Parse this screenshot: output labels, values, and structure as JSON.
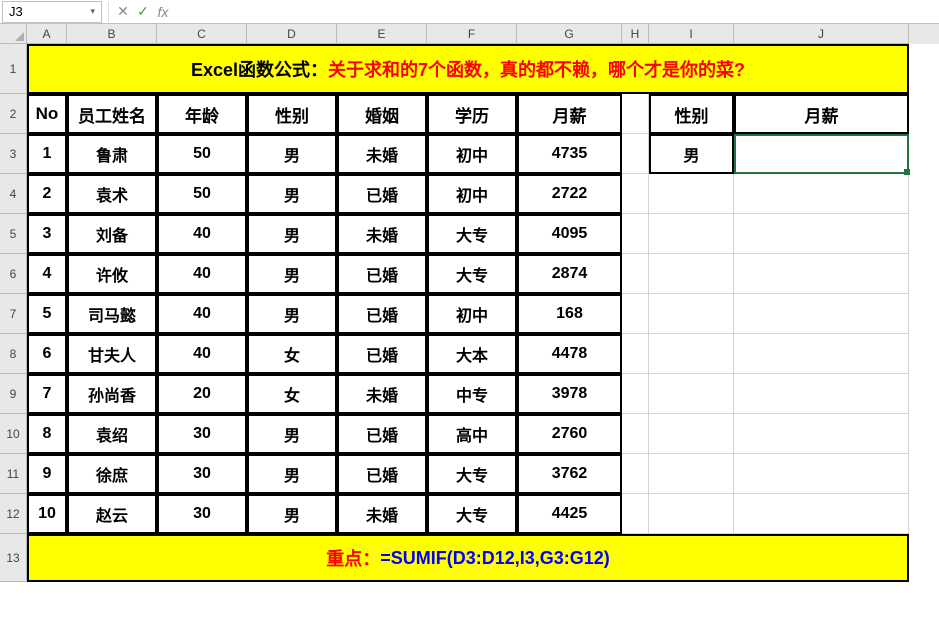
{
  "nameBox": "J3",
  "formulaInput": "",
  "columns": [
    "A",
    "B",
    "C",
    "D",
    "E",
    "F",
    "G",
    "H",
    "I",
    "J"
  ],
  "rowNums": [
    "1",
    "2",
    "3",
    "4",
    "5",
    "6",
    "7",
    "8",
    "9",
    "10",
    "11",
    "12",
    "13"
  ],
  "title": {
    "black": "Excel函数公式：",
    "red": "关于求和的7个函数，真的都不赖，哪个才是你的菜?"
  },
  "headers": {
    "no": "No",
    "name": "员工姓名",
    "age": "年龄",
    "gender": "性别",
    "marriage": "婚姻",
    "education": "学历",
    "salary": "月薪"
  },
  "sideHeaders": {
    "gender": "性别",
    "salary": "月薪"
  },
  "sideValue": "男",
  "rows": [
    {
      "no": "1",
      "name": "鲁肃",
      "age": "50",
      "gender": "男",
      "marriage": "未婚",
      "education": "初中",
      "salary": "4735"
    },
    {
      "no": "2",
      "name": "袁术",
      "age": "50",
      "gender": "男",
      "marriage": "已婚",
      "education": "初中",
      "salary": "2722"
    },
    {
      "no": "3",
      "name": "刘备",
      "age": "40",
      "gender": "男",
      "marriage": "未婚",
      "education": "大专",
      "salary": "4095"
    },
    {
      "no": "4",
      "name": "许攸",
      "age": "40",
      "gender": "男",
      "marriage": "已婚",
      "education": "大专",
      "salary": "2874"
    },
    {
      "no": "5",
      "name": "司马懿",
      "age": "40",
      "gender": "男",
      "marriage": "已婚",
      "education": "初中",
      "salary": "168"
    },
    {
      "no": "6",
      "name": "甘夫人",
      "age": "40",
      "gender": "女",
      "marriage": "已婚",
      "education": "大本",
      "salary": "4478"
    },
    {
      "no": "7",
      "name": "孙尚香",
      "age": "20",
      "gender": "女",
      "marriage": "未婚",
      "education": "中专",
      "salary": "3978"
    },
    {
      "no": "8",
      "name": "袁绍",
      "age": "30",
      "gender": "男",
      "marriage": "已婚",
      "education": "高中",
      "salary": "2760"
    },
    {
      "no": "9",
      "name": "徐庶",
      "age": "30",
      "gender": "男",
      "marriage": "已婚",
      "education": "大专",
      "salary": "3762"
    },
    {
      "no": "10",
      "name": "赵云",
      "age": "30",
      "gender": "男",
      "marriage": "未婚",
      "education": "大专",
      "salary": "4425"
    }
  ],
  "formulaRow": {
    "label": "重点：",
    "formula": "=SUMIF(D3:D12,I3,G3:G12)"
  },
  "icons": {
    "dropdown": "▾",
    "cancel": "✕",
    "enter": "✓",
    "fx": "fx"
  }
}
